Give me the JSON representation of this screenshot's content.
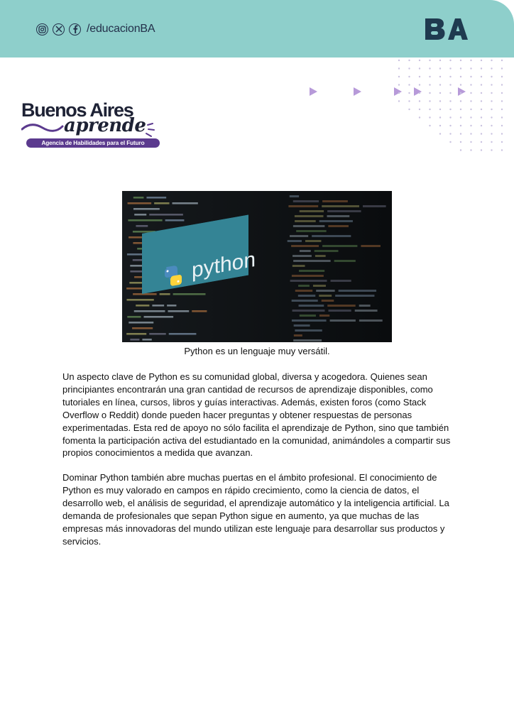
{
  "header": {
    "social_handle": "/educacionBA",
    "social_icons": [
      "instagram-icon",
      "x-icon",
      "facebook-icon"
    ],
    "ba_logo_text": "BA",
    "band_color": "#8ecfcb"
  },
  "brand": {
    "title": "Buenos Aires",
    "subtitle": "aprende",
    "tagline": "Agencia de Habilidades para el Futuro",
    "accent_color": "#5b3a8e"
  },
  "figure": {
    "image_text": "python",
    "caption": "Python es un lenguaje muy versátil."
  },
  "body": {
    "paragraph_1": "Un aspecto clave de Python es su comunidad global, diversa y acogedora. Quienes sean principiantes encontrarán una gran cantidad de recursos de aprendizaje disponibles, como tutoriales en línea, cursos, libros y guías interactivas. Además, existen foros (como Stack Overflow o Reddit) donde pueden hacer preguntas y obtener respuestas de personas experimentadas. Esta red de apoyo no sólo facilita el aprendizaje de Python, sino que también fomenta la participación activa del estudiantado en la comunidad, animándoles a compartir sus propios conocimientos a medida que avanzan.",
    "paragraph_2": "Dominar Python también abre muchas puertas en el ámbito profesional. El conocimiento de Python es muy valorado en campos en rápido crecimiento, como la ciencia de datos, el desarrollo web, el análisis de seguridad, el aprendizaje automático y la inteligencia artificial. La demanda de profesionales que sepan Python sigue en aumento, ya que muchas de las empresas más innovadoras del mundo utilizan este lenguaje para desarrollar sus productos y servicios."
  }
}
